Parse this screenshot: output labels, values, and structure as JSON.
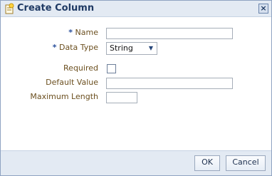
{
  "dialog": {
    "title": "Create Column",
    "icons": {
      "title": "add-column-icon",
      "close": "close-icon"
    }
  },
  "form": {
    "name_label": "Name",
    "name_value": "",
    "data_type_label": "Data Type",
    "data_type_value": "String",
    "required_label": "Required",
    "required_checked": false,
    "default_value_label": "Default Value",
    "default_value_value": "",
    "max_length_label": "Maximum Length",
    "max_length_value": "",
    "required_marker": "*"
  },
  "buttons": {
    "ok": "OK",
    "cancel": "Cancel"
  },
  "colors": {
    "title_text": "#1f3a64",
    "label_text": "#6b4f1f",
    "required_marker": "#2a4f9b",
    "panel_bg": "#e3eaf3"
  }
}
